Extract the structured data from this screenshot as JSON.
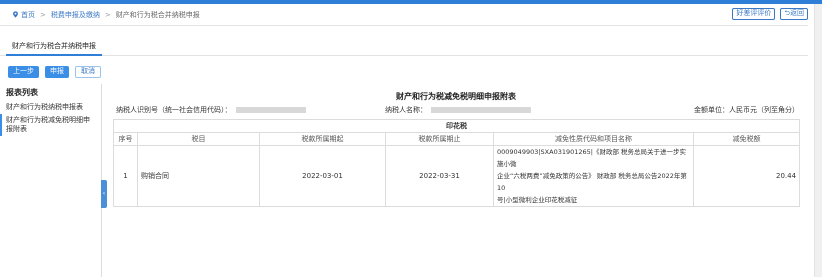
{
  "breadcrumb": {
    "home": "首页",
    "level2": "税费申报及缴纳",
    "current": "财产和行为税合并纳税申报"
  },
  "top_actions": {
    "rate_label": "好差评评价",
    "back_label": "返回"
  },
  "tab": {
    "label": "财产和行为税合并纳税申报"
  },
  "toolbar": {
    "prev_label": "上一步",
    "submit_label": "申报",
    "cancel_label": "取消"
  },
  "sidebar": {
    "title": "报表列表",
    "items": [
      {
        "label": "财产和行为税纳税申报表"
      },
      {
        "label": "财产和行为税减免税明细申报附表"
      }
    ]
  },
  "form": {
    "title": "财产和行为税减免税明细申报附表",
    "taxpayer_id_label": "纳税人识别号（统一社会信用代码）：",
    "taxpayer_name_label": "纳税人名称：",
    "unit_label": "金额单位：人民币元（列至角分）",
    "section_title": "印花税",
    "columns": [
      "序号",
      "税目",
      "税款所属期起",
      "税款所属期止",
      "减免性质代码和项目名称",
      "减免税额"
    ],
    "rows": [
      {
        "index": "1",
        "item": "购销合同",
        "period_start": "2022-03-01",
        "period_end": "2022-03-31",
        "nature_line1": "0009049903|SXA031901265|《财政部 税务总局关于进一步实施小微",
        "nature_line2": "企业“六税两费”减免政策的公告》 财政部 税务总局公告2022年第10",
        "nature_line3": "号|小型微利企业印花税减征",
        "amount": "20.44"
      }
    ]
  },
  "colors": {
    "accent": "#3a8ee6",
    "link": "#3a78c4",
    "border": "#dcdcdc"
  }
}
